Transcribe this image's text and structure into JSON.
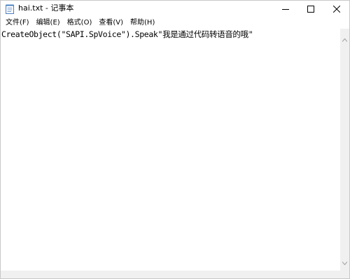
{
  "window": {
    "title": "hai.txt - 记事本"
  },
  "title_controls": {
    "minimize": "minimize-icon",
    "maximize": "maximize-icon",
    "close": "close-icon"
  },
  "menu": {
    "items": [
      {
        "label": "文件(F)"
      },
      {
        "label": "编辑(E)"
      },
      {
        "label": "格式(O)"
      },
      {
        "label": "查看(V)"
      },
      {
        "label": "帮助(H)"
      }
    ]
  },
  "editor": {
    "content": "CreateObject(\"SAPI.SpVoice\").Speak\"我是通过代码转语音的哦\""
  }
}
